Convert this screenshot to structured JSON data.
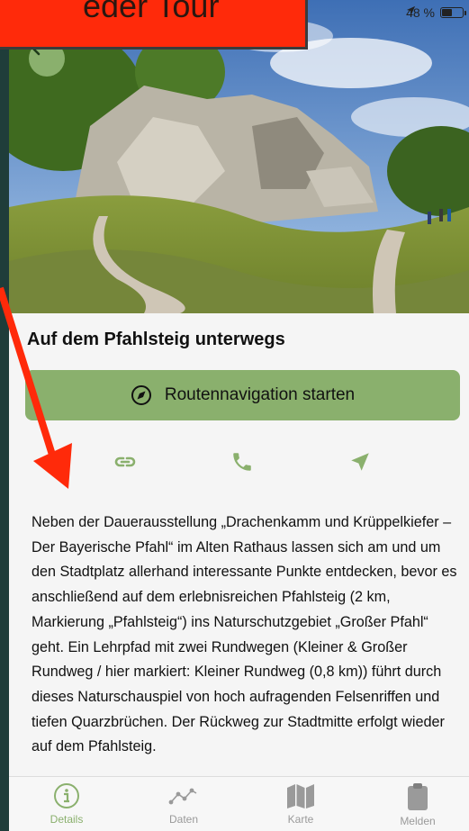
{
  "overlay": {
    "text": "eder Tour"
  },
  "status": {
    "battery": "48 %",
    "battery_level": 0.48
  },
  "detail": {
    "title": "Auf dem Pfahlsteig unterwegs",
    "route_button": "Routennavigation starten",
    "description": "Neben der Dauerausstellung „Drachenkamm und Krüppelkiefer – Der Bayerische Pfahl“ im Alten Rathaus lassen sich am und um den Stadtplatz allerhand interessante Punkte entdecken, bevor es anschließend auf dem erlebnisreichen Pfahlsteig (2 km, Markierung „Pfahlsteig“) ins Naturschutzgebiet „Großer Pfahl“ geht. Ein Lehrpfad mit zwei Rundwegen (Kleiner & Großer Rundweg / hier markiert: Kleiner Rundweg (0,8 km)) führt durch dieses Naturschauspiel von hoch aufragenden Felsenriffen und tiefen Quarzbrüchen. Der Rückweg zur Stadtmitte erfolgt wieder auf dem Pfahlsteig."
  },
  "tabs": [
    {
      "label": "Details",
      "icon": "info-icon",
      "active": true
    },
    {
      "label": "Daten",
      "icon": "chart-line-icon",
      "active": false
    },
    {
      "label": "Karte",
      "icon": "map-icon",
      "active": false
    },
    {
      "label": "Melden",
      "icon": "clipboard-icon",
      "active": false
    }
  ],
  "colors": {
    "accent": "#8ab06d",
    "overlay_red": "#ff2a0a",
    "tab_inactive": "#9a9a9a"
  }
}
